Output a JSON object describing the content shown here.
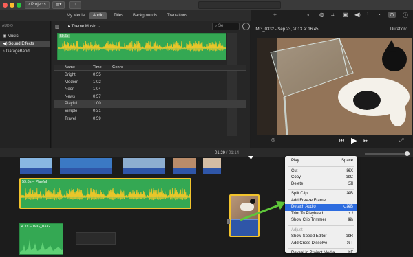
{
  "titlebar": {
    "back_label": "Projects"
  },
  "tabs": [
    {
      "label": "My Media",
      "selected": false
    },
    {
      "label": "Audio",
      "selected": true
    },
    {
      "label": "Titles",
      "selected": false
    },
    {
      "label": "Backgrounds",
      "selected": false
    },
    {
      "label": "Transitions",
      "selected": false
    }
  ],
  "sidebar": {
    "header": "AUDIO",
    "items": [
      {
        "label": "Music",
        "selected": false
      },
      {
        "label": "Sound Effects",
        "selected": true
      },
      {
        "label": "GarageBand",
        "selected": false
      }
    ]
  },
  "browser": {
    "dropdown": "Theme Music",
    "search_placeholder": "Se",
    "waveform_label": "59.6s",
    "columns": [
      "Name",
      "Time",
      "Genre"
    ],
    "rows": [
      {
        "name": "Bright",
        "time": "0:55",
        "genre": ""
      },
      {
        "name": "Modern",
        "time": "1:02",
        "genre": ""
      },
      {
        "name": "Neon",
        "time": "1:04",
        "genre": ""
      },
      {
        "name": "News",
        "time": "0:57",
        "genre": ""
      },
      {
        "name": "Playful",
        "time": "1:00",
        "genre": "",
        "selected": true
      },
      {
        "name": "Simple",
        "time": "0:31",
        "genre": ""
      },
      {
        "name": "Travel",
        "time": "0:59",
        "genre": ""
      }
    ]
  },
  "viewer": {
    "clip_title": "IMG_0332 - Sep 23, 2013 at 16:45",
    "duration_label": "Duration:"
  },
  "timeline": {
    "current_time": "01:29",
    "total_time": "01:14",
    "audio_clip_label": "59.6s – Playful",
    "video_clip_label": "4.1s – IMG_0332"
  },
  "context_menu": {
    "items": [
      {
        "label": "Play",
        "shortcut": "Space",
        "state": "normal"
      },
      {
        "separator": true
      },
      {
        "label": "Cut",
        "shortcut": "⌘X",
        "state": "normal"
      },
      {
        "label": "Copy",
        "shortcut": "⌘C",
        "state": "normal"
      },
      {
        "label": "Delete",
        "shortcut": "⌫",
        "state": "normal"
      },
      {
        "separator": true
      },
      {
        "label": "Split Clip",
        "shortcut": "⌘B",
        "state": "normal"
      },
      {
        "label": "Add Freeze Frame",
        "shortcut": "",
        "state": "normal"
      },
      {
        "label": "Detach Audio",
        "shortcut": "⌥⌘B",
        "state": "highlighted"
      },
      {
        "label": "Trim To Playhead",
        "shortcut": "⌥/",
        "state": "normal"
      },
      {
        "label": "Show Clip Trimmer",
        "shortcut": "⌘\\",
        "state": "normal"
      },
      {
        "separator": true
      },
      {
        "label": "Adjust",
        "shortcut": "",
        "state": "disabled"
      },
      {
        "label": "Show Speed Editor",
        "shortcut": "⌘R",
        "state": "normal"
      },
      {
        "label": "Add Cross Dissolve",
        "shortcut": "⌘T",
        "state": "normal"
      },
      {
        "separator": true
      },
      {
        "label": "Reveal in Project Media",
        "shortcut": "⇧F",
        "state": "normal"
      }
    ]
  },
  "colors": {
    "audio_green": "#34a853",
    "waveform_yellow": "#e8c62a",
    "video_blue": "#2f56a8",
    "selection_yellow": "#f2c32c",
    "menu_highlight": "#2d6cdf",
    "arrow_green": "#5fc63a"
  }
}
